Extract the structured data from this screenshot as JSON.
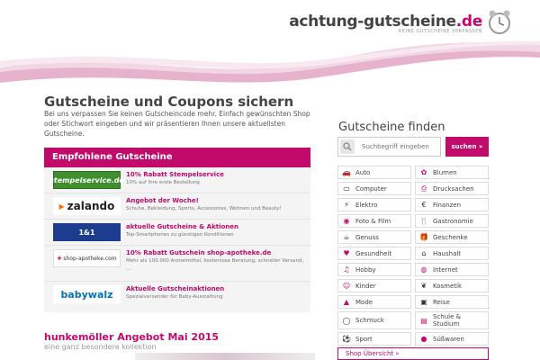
{
  "header": {
    "logo_main": "achtung-gutscheine",
    "logo_tld": ".de",
    "logo_tagline": "KEINE GUTSCHEINE VERPASSEN"
  },
  "colors": {
    "accent": "#c20a6b"
  },
  "main": {
    "title": "Gutscheine und Coupons sichern",
    "intro": "Bei uns verpassen Sie keinen Gutscheincode mehr. Einfach gewünschten Shop oder Stichwort eingeben und wir präsentieren Ihnen unsere aktuellsten Gutscheine."
  },
  "recommended": {
    "heading": "Empfohlene Gutscheine",
    "items": [
      {
        "logo": "stempelservice.de",
        "title": "10% Rabatt Stempelservice",
        "desc": "10% auf Ihre erste Bestellung"
      },
      {
        "logo": "zalando",
        "title": "Angebot der Woche!",
        "desc": "Schuhe, Bekleidung, Sports, Accessoires, Wohnen und Beauty!"
      },
      {
        "logo": "1&1",
        "title": "aktuelle Gutscheine & Aktionen",
        "desc": "Top-Smartphones zu günstigen Konditionen"
      },
      {
        "logo": "shop-apotheke.com",
        "title": "10% Rabatt Gutschein shop-apotheke.de",
        "desc": "Mehr als 100.000 Arzneimittel, kostenlose Beratung, schneller Versand, ..."
      },
      {
        "logo": "babywalz",
        "title": "Aktuelle Gutscheinaktionen",
        "desc": "Spezialversender für Baby-Ausstattung"
      }
    ]
  },
  "promo": {
    "title": "hunkemöller Angebot Mai 2015",
    "subtitle": "eine ganz besondere kollektion"
  },
  "finder": {
    "title": "Gutscheine finden",
    "search_placeholder": "Suchbegriff eingeben",
    "search_button": "suchen »",
    "categories": [
      {
        "label": "Auto",
        "icon": "car-icon"
      },
      {
        "label": "Blumen",
        "icon": "flower-icon"
      },
      {
        "label": "Computer",
        "icon": "laptop-icon"
      },
      {
        "label": "Drucksachen",
        "icon": "printer-icon"
      },
      {
        "label": "Elektro",
        "icon": "plug-icon"
      },
      {
        "label": "Finanzen",
        "icon": "money-icon"
      },
      {
        "label": "Foto & Film",
        "icon": "camera-icon"
      },
      {
        "label": "Gastronomie",
        "icon": "cutlery-icon"
      },
      {
        "label": "Genuss",
        "icon": "cup-icon"
      },
      {
        "label": "Geschenke",
        "icon": "gift-icon"
      },
      {
        "label": "Gesundheit",
        "icon": "heart-icon"
      },
      {
        "label": "Haushalt",
        "icon": "house-icon"
      },
      {
        "label": "Hobby",
        "icon": "guitar-icon"
      },
      {
        "label": "Internet",
        "icon": "globe-icon"
      },
      {
        "label": "Kinder",
        "icon": "teddy-icon"
      },
      {
        "label": "Kosmetik",
        "icon": "lipstick-icon"
      },
      {
        "label": "Mode",
        "icon": "hanger-icon"
      },
      {
        "label": "Reise",
        "icon": "suitcase-icon"
      },
      {
        "label": "Schmuck",
        "icon": "ring-icon"
      },
      {
        "label": "Schule & Studium",
        "icon": "books-icon"
      },
      {
        "label": "Sport",
        "icon": "ball-icon"
      },
      {
        "label": "Süßwaren",
        "icon": "candy-icon"
      }
    ],
    "overview_link": "Shop Übersicht »"
  }
}
